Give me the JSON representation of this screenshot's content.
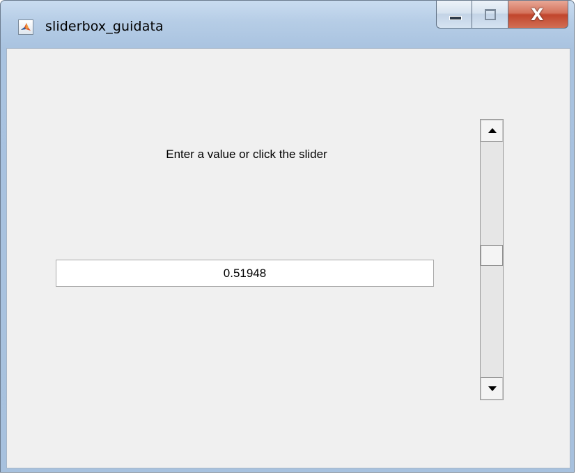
{
  "window": {
    "title": "sliderbox_guidata",
    "app_icon": "matlab-icon",
    "caption_buttons": {
      "minimize": "minimize-icon",
      "maximize": "maximize-icon",
      "close_label": "X"
    }
  },
  "main": {
    "instruction_text": "Enter a value or click the slider",
    "value_field": {
      "value": "0.51948"
    },
    "slider": {
      "orientation": "vertical",
      "position": 0.51948
    }
  },
  "colors": {
    "panel_background": "#f0f0f0",
    "titlebar": "#b6cde6",
    "close_button": "#c1452c"
  }
}
